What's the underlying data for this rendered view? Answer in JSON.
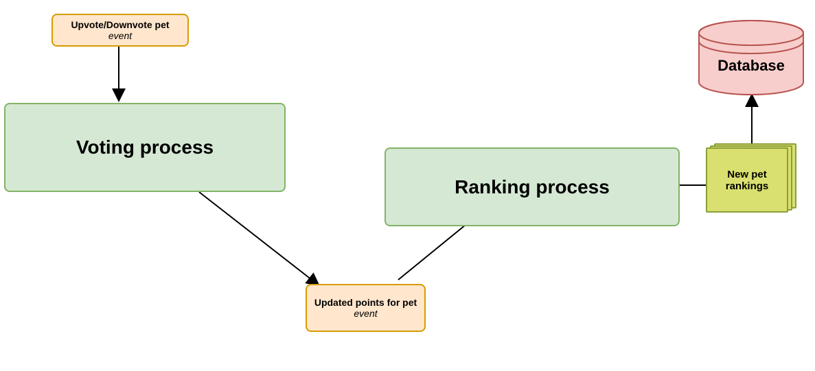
{
  "eventUpvote": {
    "title": "Upvote/Downvote pet",
    "subtitle": "event"
  },
  "votingProcess": {
    "label": "Voting process"
  },
  "eventUpdated": {
    "title": "Updated points for pet",
    "subtitle": "event"
  },
  "rankingProcess": {
    "label": "Ranking process"
  },
  "newRankings": {
    "label": "New pet rankings"
  },
  "database": {
    "label": "Database"
  }
}
